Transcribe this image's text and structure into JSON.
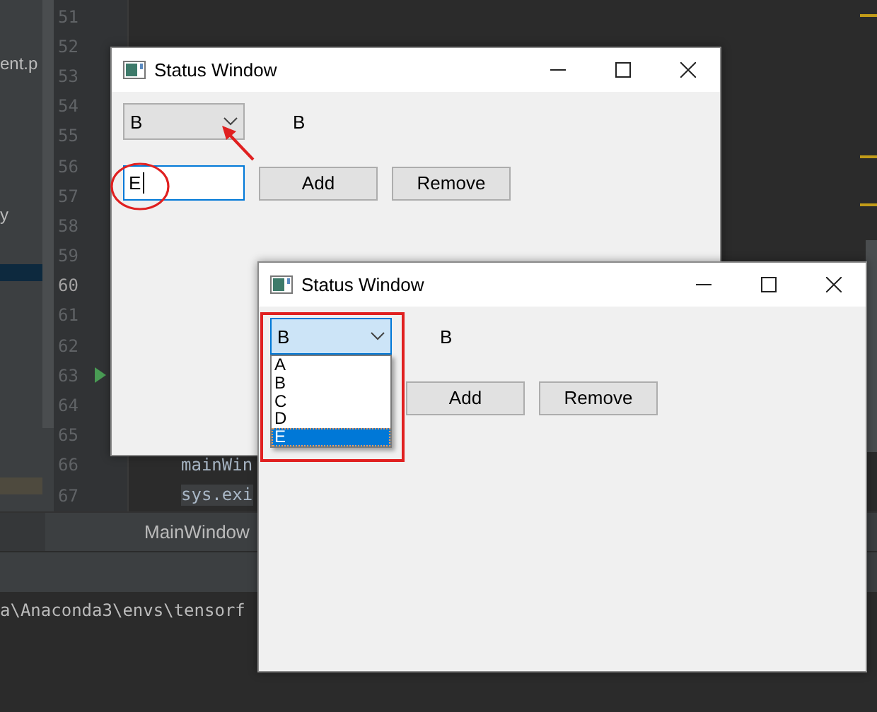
{
  "ide": {
    "project_items": [
      "ent.p",
      "y"
    ],
    "line_numbers": [
      {
        "number": "51",
        "current": false
      },
      {
        "number": "52",
        "current": false
      },
      {
        "number": "53",
        "current": false
      },
      {
        "number": "54",
        "current": false
      },
      {
        "number": "55",
        "current": false
      },
      {
        "number": "56",
        "current": false
      },
      {
        "number": "57",
        "current": false
      },
      {
        "number": "58",
        "current": false
      },
      {
        "number": "59",
        "current": false
      },
      {
        "number": "60",
        "current": true
      },
      {
        "number": "61",
        "current": false
      },
      {
        "number": "62",
        "current": false
      },
      {
        "number": "63",
        "current": false,
        "run": true
      },
      {
        "number": "64",
        "current": false
      },
      {
        "number": "65",
        "current": false
      },
      {
        "number": "66",
        "current": false,
        "code": "mainWin",
        "highlighted": false
      },
      {
        "number": "67",
        "current": false,
        "code": "sys.exi",
        "highlighted": true
      }
    ],
    "editor_tab": "MainWindow",
    "terminal_line": "a\\Anaconda3\\envs\\tensorf"
  },
  "windows": [
    {
      "title": "Status Window",
      "combo": {
        "value": "B",
        "open": false
      },
      "label": "B",
      "input": {
        "value": "E",
        "focused": true
      },
      "buttons": [
        "Add",
        "Remove"
      ],
      "highlight": {
        "kind": "ellipse"
      }
    },
    {
      "title": "Status Window",
      "combo": {
        "value": "B",
        "open": true,
        "options": [
          {
            "label": "A",
            "highlighted": false
          },
          {
            "label": "B",
            "highlighted": false
          },
          {
            "label": "C",
            "highlighted": false
          },
          {
            "label": "D",
            "highlighted": false
          },
          {
            "label": "E",
            "highlighted": true
          }
        ]
      },
      "label": "B",
      "buttons": [
        "Add",
        "Remove"
      ],
      "highlight": {
        "kind": "rectangle"
      }
    }
  ]
}
